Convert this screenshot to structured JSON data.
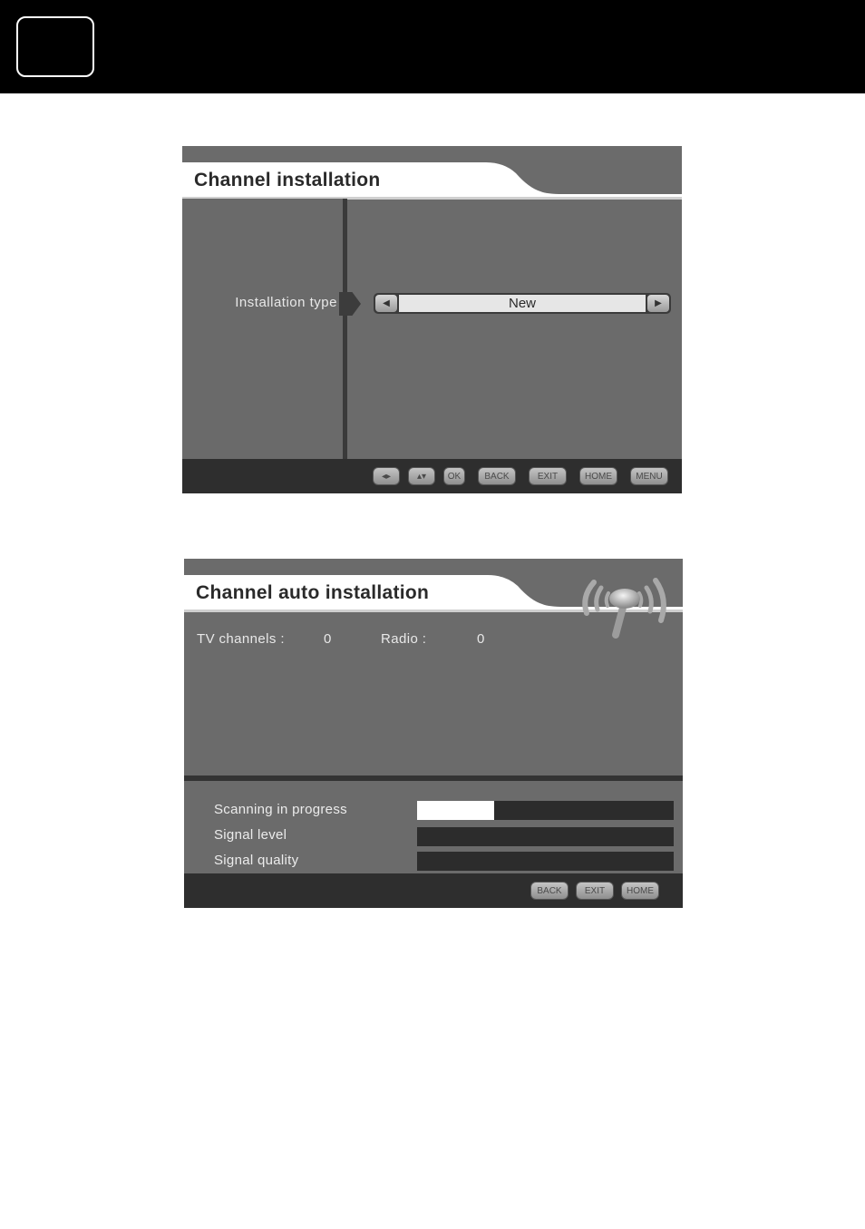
{
  "page": {
    "header_box_icon": "page-number-frame"
  },
  "screen1": {
    "title": "Channel installation",
    "option_label": "Installation type",
    "option_value": "New",
    "left_arrow": "◀",
    "right_arrow": "▶",
    "footer_keys": [
      {
        "label": "◂▸",
        "icon": "left-right-arrows-icon"
      },
      {
        "label": "▴▾",
        "icon": "up-down-arrows-icon"
      },
      {
        "label": "OK"
      },
      {
        "label": "BACK"
      },
      {
        "label": "EXIT"
      },
      {
        "label": "HOME"
      },
      {
        "label": "MENU"
      }
    ]
  },
  "screen2": {
    "title": "Channel auto installation",
    "antenna_icon": "antenna-signal-icon",
    "tv_channels_label": "TV channels :",
    "tv_channels_value": "0",
    "radio_label": "Radio :",
    "radio_value": "0",
    "rows": [
      {
        "label": "Scanning in progress",
        "progress_percent": 30
      },
      {
        "label": "Signal level",
        "progress_percent": 0
      },
      {
        "label": "Signal quality",
        "progress_percent": 0
      }
    ],
    "footer_keys": [
      {
        "label": "BACK"
      },
      {
        "label": "EXIT"
      },
      {
        "label": "HOME"
      }
    ]
  }
}
